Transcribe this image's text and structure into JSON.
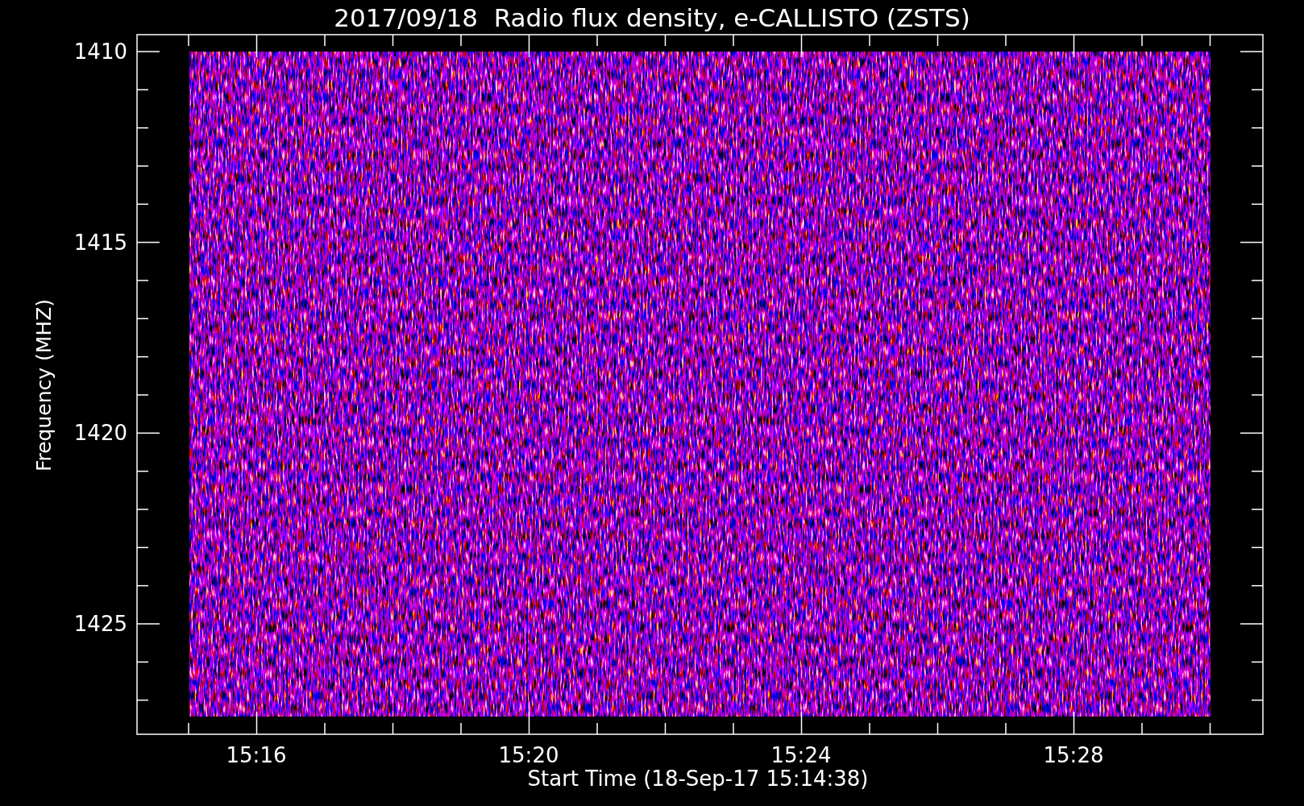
{
  "title": "2017/09/18  Radio flux density, e-CALLISTO (ZSTS)",
  "y_axis": {
    "label": "Frequency (MHZ)",
    "ticks": [
      "1410",
      "1415",
      "1420",
      "1425"
    ]
  },
  "x_axis": {
    "label": "Start Time (18-Sep-17 15:14:38)",
    "ticks": [
      "15:16",
      "15:20",
      "15:24",
      "15:28"
    ]
  }
}
